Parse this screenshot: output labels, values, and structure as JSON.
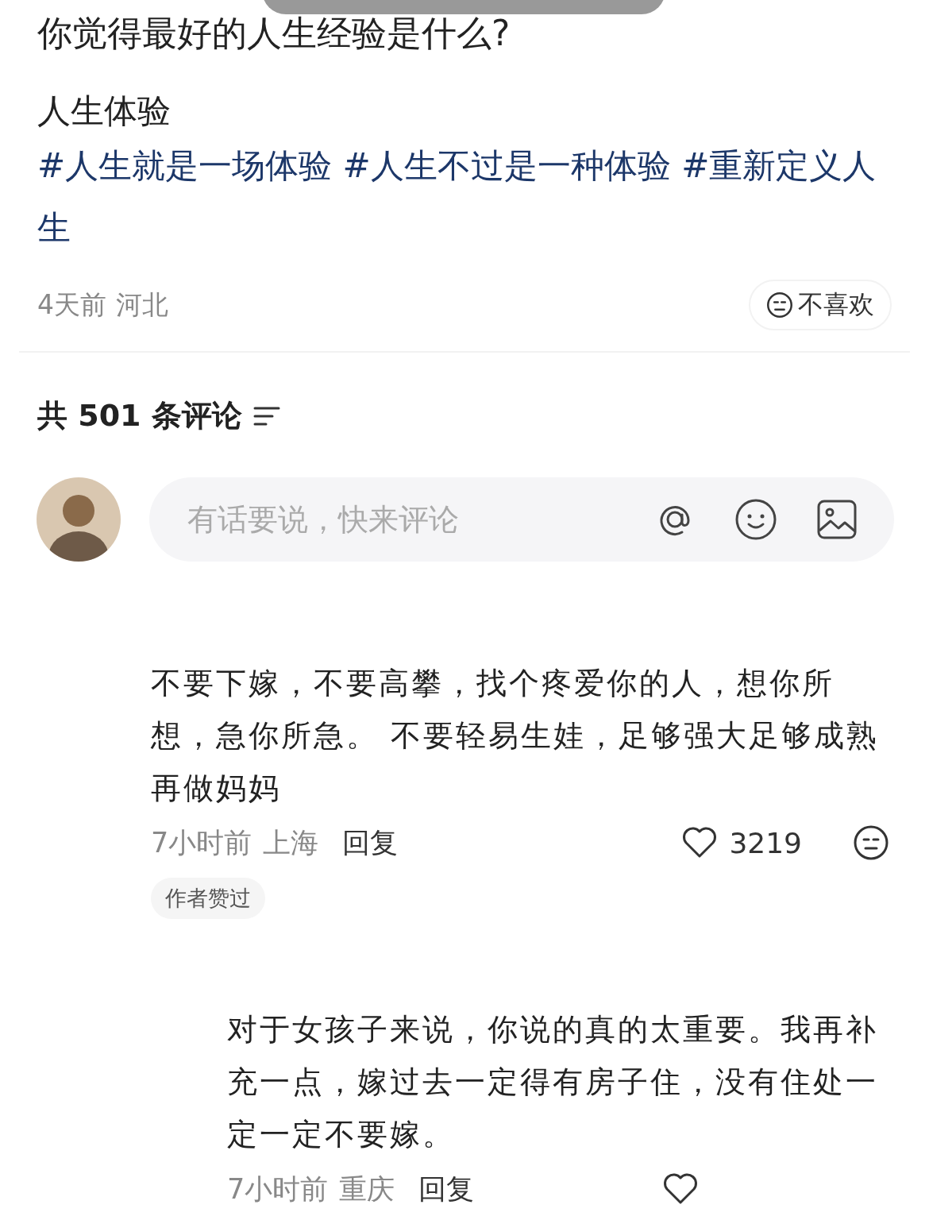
{
  "question": {
    "title": "你觉得最好的人生经验是什么?",
    "body": "人生体验",
    "tags": [
      "#人生就是一场体验",
      "#人生不过是一种体验",
      "#重新定义人生"
    ],
    "time": "4天前",
    "location": "河北",
    "dislike_label": "不喜欢"
  },
  "comments_header": {
    "label": "共 501 条评论"
  },
  "composer": {
    "placeholder": "有话要说，快来评论"
  },
  "comments": [
    {
      "text": "不要下嫁，不要高攀，找个疼爱你的人，想你所想，急你所急。 不要轻易生娃，足够强大足够成熟再做妈妈",
      "time": "7小时前",
      "location": "上海",
      "reply_label": "回复",
      "likes": "3219",
      "badge": "作者赞过",
      "replies": [
        {
          "text": "对于女孩子来说，你说的真的太重要。我再补充一点，嫁过去一定得有房子住，没有住处一定一定不要嫁。",
          "time": "7小时前",
          "location": "重庆",
          "reply_label": "回复"
        }
      ]
    }
  ]
}
